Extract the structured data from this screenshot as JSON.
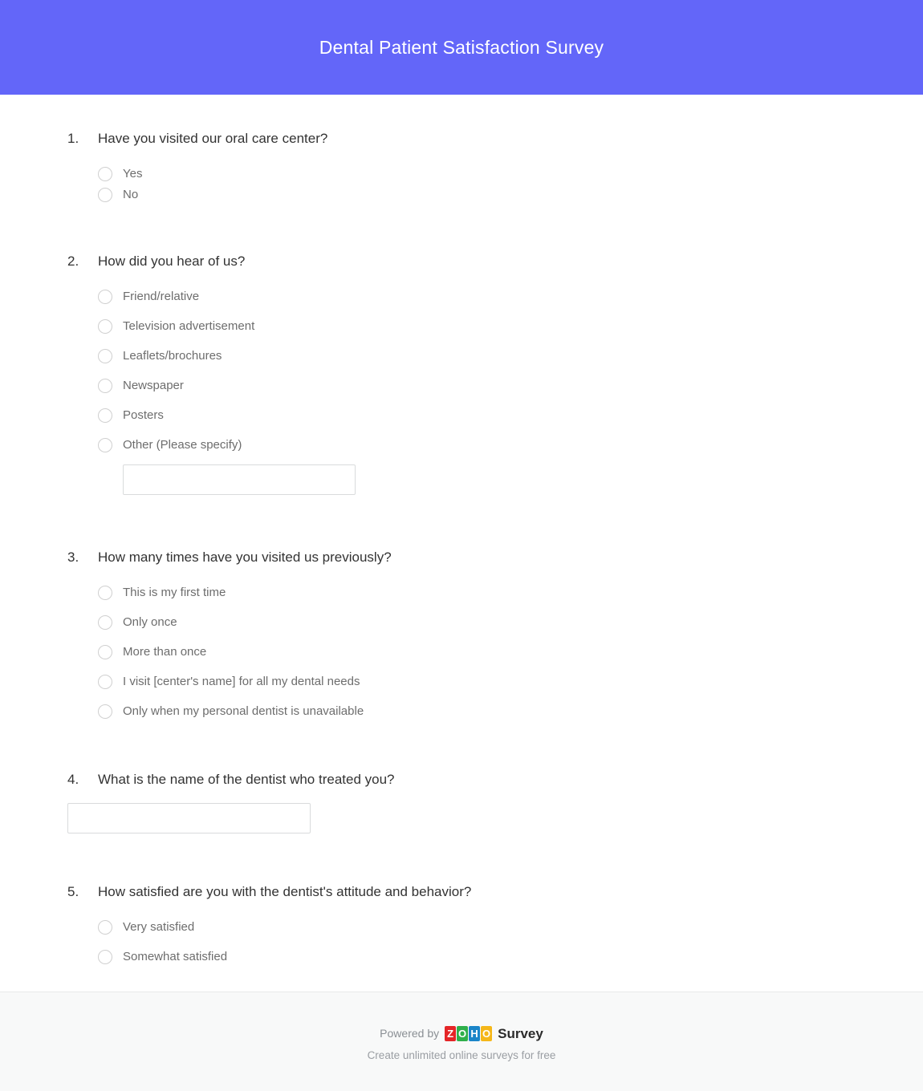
{
  "header": {
    "title": "Dental Patient Satisfaction Survey",
    "background_color": "#6366f9",
    "title_color": "#ffffff"
  },
  "questions": [
    {
      "number": "1.",
      "text": "Have you visited our oral care center?",
      "type": "radio-inline",
      "options": [
        {
          "label": "Yes"
        },
        {
          "label": "No"
        }
      ]
    },
    {
      "number": "2.",
      "text": "How did you hear of us?",
      "type": "radio",
      "options": [
        {
          "label": "Friend/relative"
        },
        {
          "label": "Television advertisement"
        },
        {
          "label": "Leaflets/brochures"
        },
        {
          "label": "Newspaper"
        },
        {
          "label": "Posters"
        },
        {
          "label": "Other (Please specify)"
        }
      ],
      "other_input": {
        "value": "",
        "placeholder": ""
      }
    },
    {
      "number": "3.",
      "text": "How many times have you visited us previously?",
      "type": "radio",
      "options": [
        {
          "label": "This is my first time"
        },
        {
          "label": "Only once"
        },
        {
          "label": "More than once"
        },
        {
          "label": "I visit [center's name] for all my dental needs"
        },
        {
          "label": "Only when my personal dentist is unavailable"
        }
      ]
    },
    {
      "number": "4.",
      "text": "What is the name of the dentist who treated you?",
      "type": "text",
      "input": {
        "value": "",
        "placeholder": ""
      }
    },
    {
      "number": "5.",
      "text": "How satisfied are you with the dentist's attitude and behavior?",
      "type": "radio",
      "options": [
        {
          "label": "Very satisfied"
        },
        {
          "label": "Somewhat satisfied"
        }
      ]
    }
  ],
  "footer": {
    "powered_by": "Powered by",
    "brand_tiles": [
      "Z",
      "O",
      "H",
      "O"
    ],
    "brand_word": "Survey",
    "tagline": "Create unlimited online surveys for free",
    "tile_colors": [
      "#e42527",
      "#2faf4b",
      "#1a85c8",
      "#f5b719"
    ]
  }
}
